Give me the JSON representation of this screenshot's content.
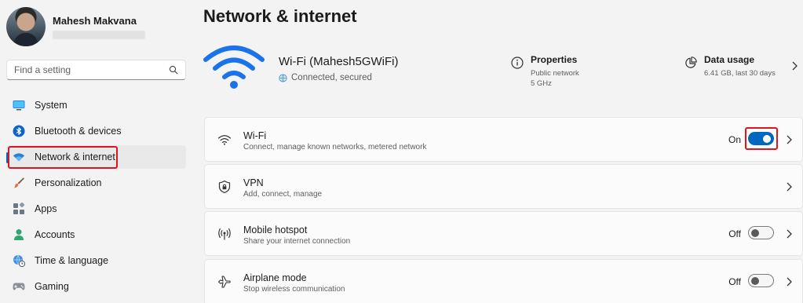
{
  "profile": {
    "name": "Mahesh Makvana"
  },
  "search": {
    "placeholder": "Find a setting"
  },
  "nav": {
    "items": [
      {
        "label": "System",
        "icon": "monitor-icon"
      },
      {
        "label": "Bluetooth & devices",
        "icon": "bluetooth-icon"
      },
      {
        "label": "Network & internet",
        "icon": "wifi-icon",
        "active": true
      },
      {
        "label": "Personalization",
        "icon": "paintbrush-icon"
      },
      {
        "label": "Apps",
        "icon": "apps-grid-icon"
      },
      {
        "label": "Accounts",
        "icon": "person-icon"
      },
      {
        "label": "Time & language",
        "icon": "globe-clock-icon"
      },
      {
        "label": "Gaming",
        "icon": "gamepad-icon"
      }
    ]
  },
  "page": {
    "title": "Network & internet"
  },
  "hero": {
    "network_name": "Wi-Fi (Mahesh5GWiFi)",
    "status": "Connected, secured",
    "properties": {
      "title": "Properties",
      "line1": "Public network",
      "line2": "5 GHz"
    },
    "data_usage": {
      "title": "Data usage",
      "detail": "6.41 GB, last 30 days"
    }
  },
  "cards": [
    {
      "title": "Wi-Fi",
      "subtitle": "Connect, manage known networks, metered network",
      "state": "On",
      "toggle_on": true,
      "icon": "wifi-small-icon"
    },
    {
      "title": "VPN",
      "subtitle": "Add, connect, manage",
      "icon": "shield-icon"
    },
    {
      "title": "Mobile hotspot",
      "subtitle": "Share your internet connection",
      "state": "Off",
      "toggle_on": false,
      "icon": "hotspot-icon"
    },
    {
      "title": "Airplane mode",
      "subtitle": "Stop wireless communication",
      "state": "Off",
      "toggle_on": false,
      "icon": "airplane-icon"
    }
  ],
  "colors": {
    "accent": "#0067c0",
    "highlight": "#e0141e",
    "wifi_blue": "#1a73e8"
  }
}
